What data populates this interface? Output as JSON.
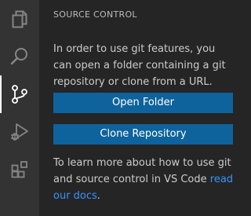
{
  "activity_bar": {
    "items": [
      {
        "icon": "explorer-icon"
      },
      {
        "icon": "search-icon"
      },
      {
        "icon": "source-control-icon",
        "active": true
      },
      {
        "icon": "run-debug-icon"
      },
      {
        "icon": "extensions-icon"
      }
    ]
  },
  "sidebar": {
    "title": "SOURCE CONTROL",
    "intro": "In order to use git features, you can open a folder containing a git repository or clone from a URL.",
    "open_folder_label": "Open Folder",
    "clone_repository_label": "Clone Repository",
    "learn_more_text": "To learn more about how to use git and source control in VS Code ",
    "learn_more_link": "read our docs",
    "learn_more_suffix": "."
  },
  "colors": {
    "activity_bar_bg": "#333333",
    "sidebar_bg": "#252526",
    "button_bg": "#0e639c",
    "link": "#3794ff",
    "text": "#cccccc"
  }
}
